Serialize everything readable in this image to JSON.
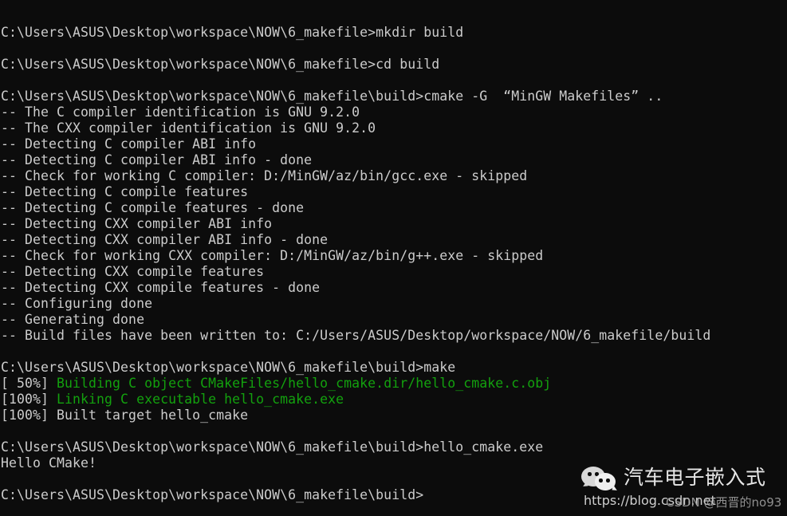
{
  "terminal": {
    "background_color": "#0c0c0c",
    "foreground_color": "#cccccc",
    "success_color": "#13a10e",
    "prompt_path_1": "C:\\Users\\ASUS\\Desktop\\workspace\\NOW\\6_makefile",
    "prompt_path_2": "C:\\Users\\ASUS\\Desktop\\workspace\\NOW\\6_makefile\\build",
    "lines": [
      {
        "id": "blank-0",
        "text": ""
      },
      {
        "id": "cmd-mkdir",
        "text": "C:\\Users\\ASUS\\Desktop\\workspace\\NOW\\6_makefile>mkdir build"
      },
      {
        "id": "blank-1",
        "text": ""
      },
      {
        "id": "cmd-cd",
        "text": "C:\\Users\\ASUS\\Desktop\\workspace\\NOW\\6_makefile>cd build"
      },
      {
        "id": "blank-2",
        "text": ""
      },
      {
        "id": "cmd-cmake",
        "text": "C:\\Users\\ASUS\\Desktop\\workspace\\NOW\\6_makefile\\build>cmake -G  “MinGW Makefiles” .."
      },
      {
        "id": "out-cc-id",
        "text": "-- The C compiler identification is GNU 9.2.0"
      },
      {
        "id": "out-cxx-id",
        "text": "-- The CXX compiler identification is GNU 9.2.0"
      },
      {
        "id": "out-c-abi",
        "text": "-- Detecting C compiler ABI info"
      },
      {
        "id": "out-c-abi-done",
        "text": "-- Detecting C compiler ABI info - done"
      },
      {
        "id": "out-c-check",
        "text": "-- Check for working C compiler: D:/MinGW/az/bin/gcc.exe - skipped"
      },
      {
        "id": "out-c-feat",
        "text": "-- Detecting C compile features"
      },
      {
        "id": "out-c-feat-done",
        "text": "-- Detecting C compile features - done"
      },
      {
        "id": "out-cxx-abi",
        "text": "-- Detecting CXX compiler ABI info"
      },
      {
        "id": "out-cxx-abi-dn",
        "text": "-- Detecting CXX compiler ABI info - done"
      },
      {
        "id": "out-cxx-check",
        "text": "-- Check for working CXX compiler: D:/MinGW/az/bin/g++.exe - skipped"
      },
      {
        "id": "out-cxx-feat",
        "text": "-- Detecting CXX compile features"
      },
      {
        "id": "out-cxx-ft-dn",
        "text": "-- Detecting CXX compile features - done"
      },
      {
        "id": "out-configuring",
        "text": "-- Configuring done"
      },
      {
        "id": "out-generating",
        "text": "-- Generating done"
      },
      {
        "id": "out-buildfiles",
        "text": "-- Build files have been written to: C:/Users/ASUS/Desktop/workspace/NOW/6_makefile/build"
      },
      {
        "id": "blank-3",
        "text": ""
      },
      {
        "id": "cmd-make",
        "text": "C:\\Users\\ASUS\\Desktop\\workspace\\NOW\\6_makefile\\build>make"
      },
      {
        "id": "make-50",
        "prefix": "[ 50%] ",
        "green": "Building C object CMakeFiles/hello_cmake.dir/hello_cmake.c.obj"
      },
      {
        "id": "make-100-link",
        "prefix": "[100%] ",
        "green": "Linking C executable hello_cmake.exe"
      },
      {
        "id": "make-100-built",
        "text": "[100%] Built target hello_cmake"
      },
      {
        "id": "blank-4",
        "text": ""
      },
      {
        "id": "cmd-run",
        "text": "C:\\Users\\ASUS\\Desktop\\workspace\\NOW\\6_makefile\\build>hello_cmake.exe"
      },
      {
        "id": "out-hello",
        "text": "Hello CMake!"
      },
      {
        "id": "blank-5",
        "text": ""
      },
      {
        "id": "cmd-prompt",
        "text": "C:\\Users\\ASUS\\Desktop\\workspace\\NOW\\6_makefile\\build>"
      }
    ]
  },
  "watermark": {
    "icon": "wechat-logo-icon",
    "title": "汽车电子嵌入式",
    "url": "https://blog.csdn.net",
    "csdn_tag": "CSDN @西晋的no93"
  }
}
